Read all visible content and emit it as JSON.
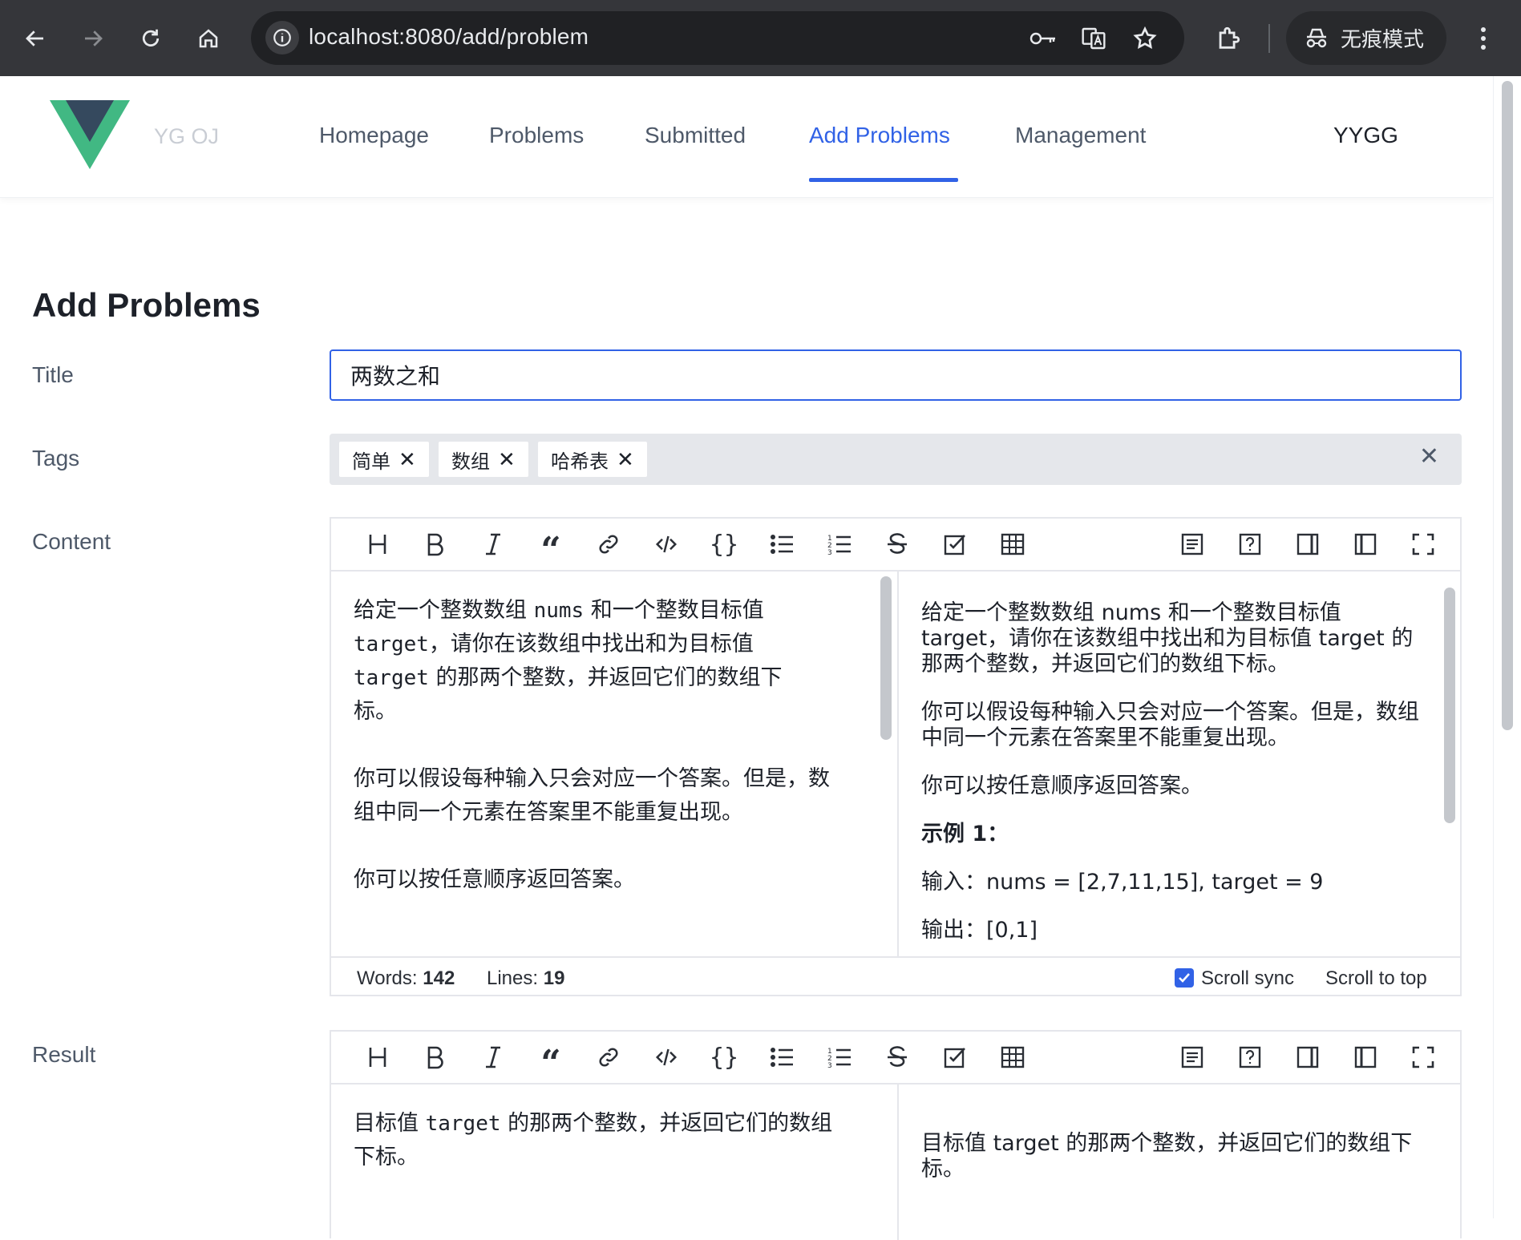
{
  "browser": {
    "url": "localhost:8080/add/problem",
    "incognito_label": "无痕模式",
    "icons": [
      "back-arrow-icon",
      "forward-arrow-icon",
      "reload-icon",
      "home-icon",
      "site-info-icon",
      "password-key-icon",
      "translate-icon",
      "bookmark-star-icon",
      "extensions-icon",
      "incognito-icon",
      "more-vert-icon"
    ]
  },
  "nav": {
    "site_name": "YG OJ",
    "items": [
      "Homepage",
      "Problems",
      "Submitted",
      "Add Problems",
      "Management"
    ],
    "active": "Add Problems",
    "user": "YYGG",
    "accent_color": "#3162e6"
  },
  "form": {
    "heading": "Add Problems",
    "title_label": "Title",
    "title_value": "两数之和",
    "tags_label": "Tags",
    "tags": [
      "简单",
      "数组",
      "哈希表"
    ],
    "content_label": "Content",
    "result_label": "Result"
  },
  "content_editor": {
    "source_lines": [
      "给定一个整数数组 nums 和一个整数目标值",
      "target，请你在该数组中找出和为目标值",
      "target 的那两个整数，并返回它们的数组下",
      "标。",
      "",
      "你可以假设每种输入只会对应一个答案。但是，数",
      "组中同一个元素在答案里不能重复出现。",
      "",
      "你可以按任意顺序返回答案。"
    ],
    "preview": {
      "p1": "给定一个整数数组 nums 和一个整数目标值 target，请你在该数组中找出和为目标值 target 的那两个整数，并返回它们的数组下标。",
      "p2": "你可以假设每种输入只会对应一个答案。但是，数组中同一个元素在答案里不能重复出现。",
      "p3": "你可以按任意顺序返回答案。",
      "example_heading": "示例 1：",
      "input_line": "输入：nums = [2,7,11,15], target = 9",
      "output_line": "输出：[0,1]"
    },
    "status": {
      "words_label": "Words:",
      "words": "142",
      "lines_label": "Lines:",
      "lines": "19",
      "scroll_sync_label": "Scroll sync",
      "scroll_sync": true,
      "scroll_top_label": "Scroll to top"
    }
  },
  "result_editor": {
    "source_lines": [
      "目标值 target 的那两个整数，并返回它们的数组",
      "下标。"
    ],
    "preview_text": "目标值 target 的那两个整数，并返回它们的数组下标。"
  },
  "toolbar_icons": [
    "heading-icon",
    "bold-icon",
    "italic-icon",
    "quote-icon",
    "link-icon",
    "code-icon",
    "code-block-icon",
    "unordered-list-icon",
    "ordered-list-icon",
    "strikethrough-icon",
    "task-list-icon",
    "table-icon",
    "toc-icon",
    "help-icon",
    "preview-only-icon",
    "editor-only-icon",
    "fullscreen-icon"
  ]
}
